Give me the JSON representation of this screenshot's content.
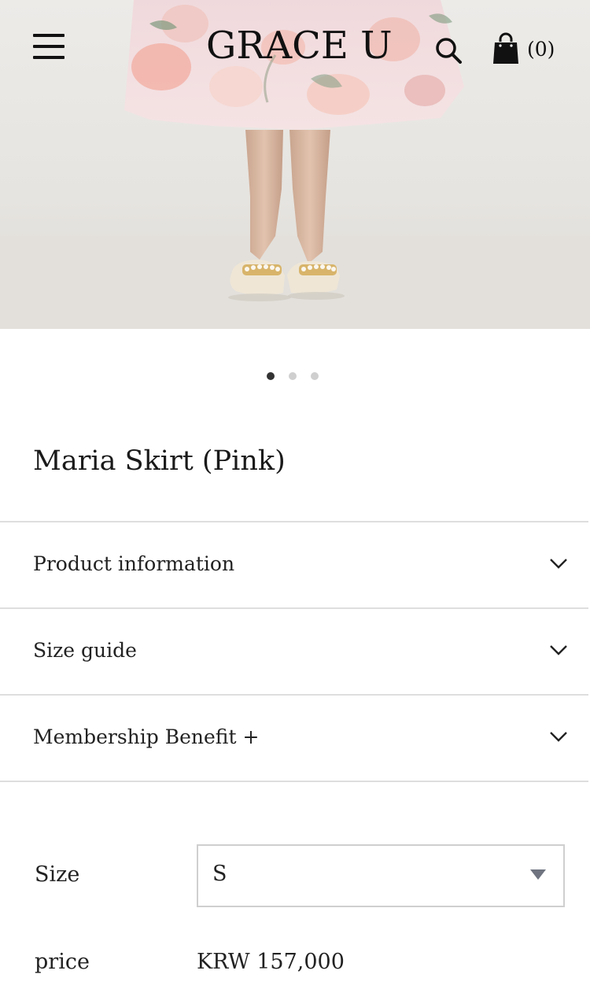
{
  "header": {
    "logo": "GRACE U",
    "cart_count": "(0)"
  },
  "carousel": {
    "slide_count": 3,
    "active_index": 0
  },
  "product": {
    "title": "Maria Skirt (Pink)"
  },
  "accordion": [
    {
      "label": "Product information"
    },
    {
      "label": "Size guide"
    },
    {
      "label": "Membership Benefit +"
    }
  ],
  "options": {
    "size_label": "Size",
    "size_value": "S",
    "price_label": "price",
    "price_value": "KRW 157,000"
  },
  "icons": {
    "menu": "hamburger-menu-icon",
    "search": "search-icon",
    "cart": "shopping-bag-icon",
    "chevron": "chevron-down-icon",
    "caret": "caret-down-icon"
  },
  "colors": {
    "text": "#1a1a1a",
    "divider": "#dedede",
    "dot_active": "#333333",
    "dot_inactive": "#cfcfcf",
    "caret": "#6f7480"
  }
}
